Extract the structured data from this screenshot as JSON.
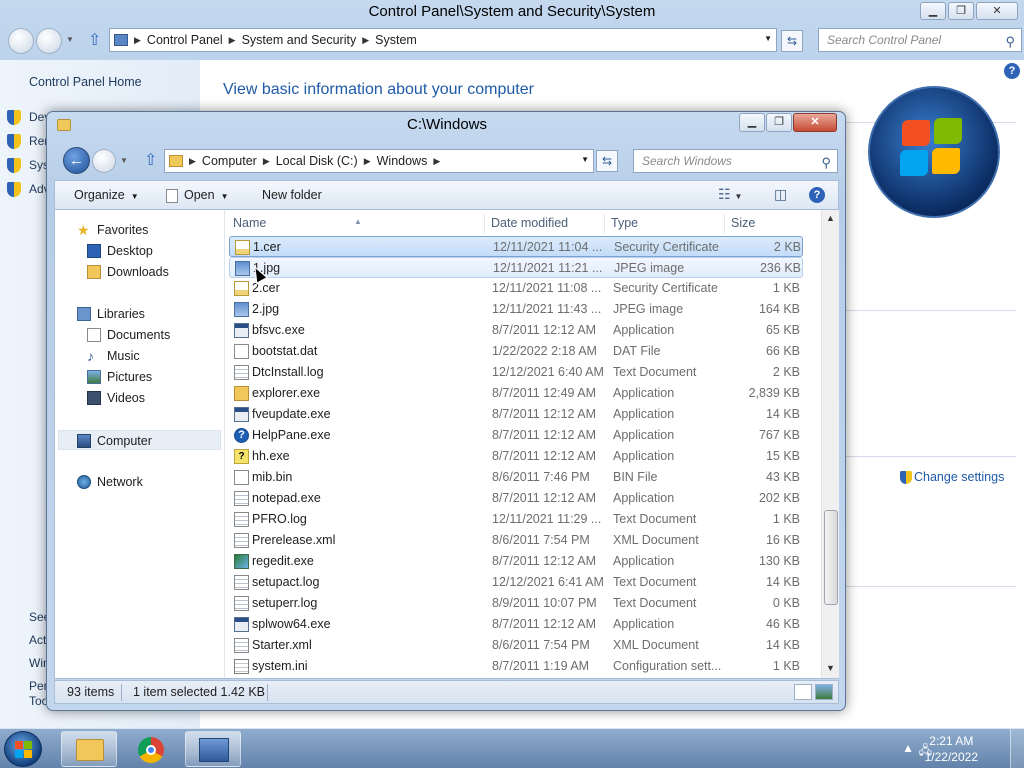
{
  "cp": {
    "title": "Control Panel\\System and Security\\System",
    "breadcrumbs": [
      "Control Panel",
      "System and Security",
      "System"
    ],
    "search_placeholder": "Search Control Panel",
    "home": "Control Panel Home",
    "side_links": [
      "Dev",
      "Rem",
      "Syst",
      "Adv"
    ],
    "see_also_links": [
      "See",
      "Acti",
      "Win",
      "Perf",
      "Too"
    ],
    "heading": "View basic information about your computer",
    "change_settings": "Change settings"
  },
  "explorer": {
    "title": "C:\\Windows",
    "breadcrumbs": [
      "Computer",
      "Local Disk (C:)",
      "Windows"
    ],
    "search_placeholder": "Search Windows",
    "toolbar": {
      "organize": "Organize",
      "open": "Open",
      "new_folder": "New folder"
    },
    "nav": {
      "favorites": "Favorites",
      "desktop": "Desktop",
      "downloads": "Downloads",
      "libraries": "Libraries",
      "documents": "Documents",
      "music": "Music",
      "pictures": "Pictures",
      "videos": "Videos",
      "computer": "Computer",
      "network": "Network"
    },
    "columns": {
      "name": "Name",
      "date": "Date modified",
      "type": "Type",
      "size": "Size"
    },
    "files": [
      {
        "name": "1.cer",
        "date": "12/11/2021 11:04 ...",
        "type": "Security Certificate",
        "size": "2 KB",
        "icon": "cert"
      },
      {
        "name": "1.jpg",
        "date": "12/11/2021 11:21 ...",
        "type": "JPEG image",
        "size": "236 KB",
        "icon": "img"
      },
      {
        "name": "2.cer",
        "date": "12/11/2021 11:08 ...",
        "type": "Security Certificate",
        "size": "1 KB",
        "icon": "cert"
      },
      {
        "name": "2.jpg",
        "date": "12/11/2021 11:43 ...",
        "type": "JPEG image",
        "size": "164 KB",
        "icon": "img"
      },
      {
        "name": "bfsvc.exe",
        "date": "8/7/2011 12:12 AM",
        "type": "Application",
        "size": "65 KB",
        "icon": "app"
      },
      {
        "name": "bootstat.dat",
        "date": "1/22/2022 2:18 AM",
        "type": "DAT File",
        "size": "66 KB",
        "icon": "blank"
      },
      {
        "name": "DtcInstall.log",
        "date": "12/12/2021 6:40 AM",
        "type": "Text Document",
        "size": "2 KB",
        "icon": "txt"
      },
      {
        "name": "explorer.exe",
        "date": "8/7/2011 12:49 AM",
        "type": "Application",
        "size": "2,839 KB",
        "icon": "folder"
      },
      {
        "name": "fveupdate.exe",
        "date": "8/7/2011 12:12 AM",
        "type": "Application",
        "size": "14 KB",
        "icon": "app"
      },
      {
        "name": "HelpPane.exe",
        "date": "8/7/2011 12:12 AM",
        "type": "Application",
        "size": "767 KB",
        "icon": "help"
      },
      {
        "name": "hh.exe",
        "date": "8/7/2011 12:12 AM",
        "type": "Application",
        "size": "15 KB",
        "icon": "hh"
      },
      {
        "name": "mib.bin",
        "date": "8/6/2011 7:46 PM",
        "type": "BIN File",
        "size": "43 KB",
        "icon": "blank"
      },
      {
        "name": "notepad.exe",
        "date": "8/7/2011 12:12 AM",
        "type": "Application",
        "size": "202 KB",
        "icon": "txt"
      },
      {
        "name": "PFRO.log",
        "date": "12/11/2021 11:29 ...",
        "type": "Text Document",
        "size": "1 KB",
        "icon": "txt"
      },
      {
        "name": "Prerelease.xml",
        "date": "8/6/2011 7:54 PM",
        "type": "XML Document",
        "size": "16 KB",
        "icon": "txt"
      },
      {
        "name": "regedit.exe",
        "date": "8/7/2011 12:12 AM",
        "type": "Application",
        "size": "130 KB",
        "icon": "reg"
      },
      {
        "name": "setupact.log",
        "date": "12/12/2021 6:41 AM",
        "type": "Text Document",
        "size": "14 KB",
        "icon": "txt"
      },
      {
        "name": "setuperr.log",
        "date": "8/9/2011 10:07 PM",
        "type": "Text Document",
        "size": "0 KB",
        "icon": "txt"
      },
      {
        "name": "splwow64.exe",
        "date": "8/7/2011 12:12 AM",
        "type": "Application",
        "size": "46 KB",
        "icon": "app"
      },
      {
        "name": "Starter.xml",
        "date": "8/6/2011 7:54 PM",
        "type": "XML Document",
        "size": "14 KB",
        "icon": "txt"
      },
      {
        "name": "system.ini",
        "date": "8/7/2011 1:19 AM",
        "type": "Configuration sett...",
        "size": "1 KB",
        "icon": "ini"
      }
    ],
    "selected_index": 0,
    "hover_index": 1,
    "status": {
      "count": "93 items",
      "selection": "1 item selected  1.42 KB"
    }
  },
  "taskbar": {
    "time": "2:21 AM",
    "date": "1/22/2022"
  }
}
